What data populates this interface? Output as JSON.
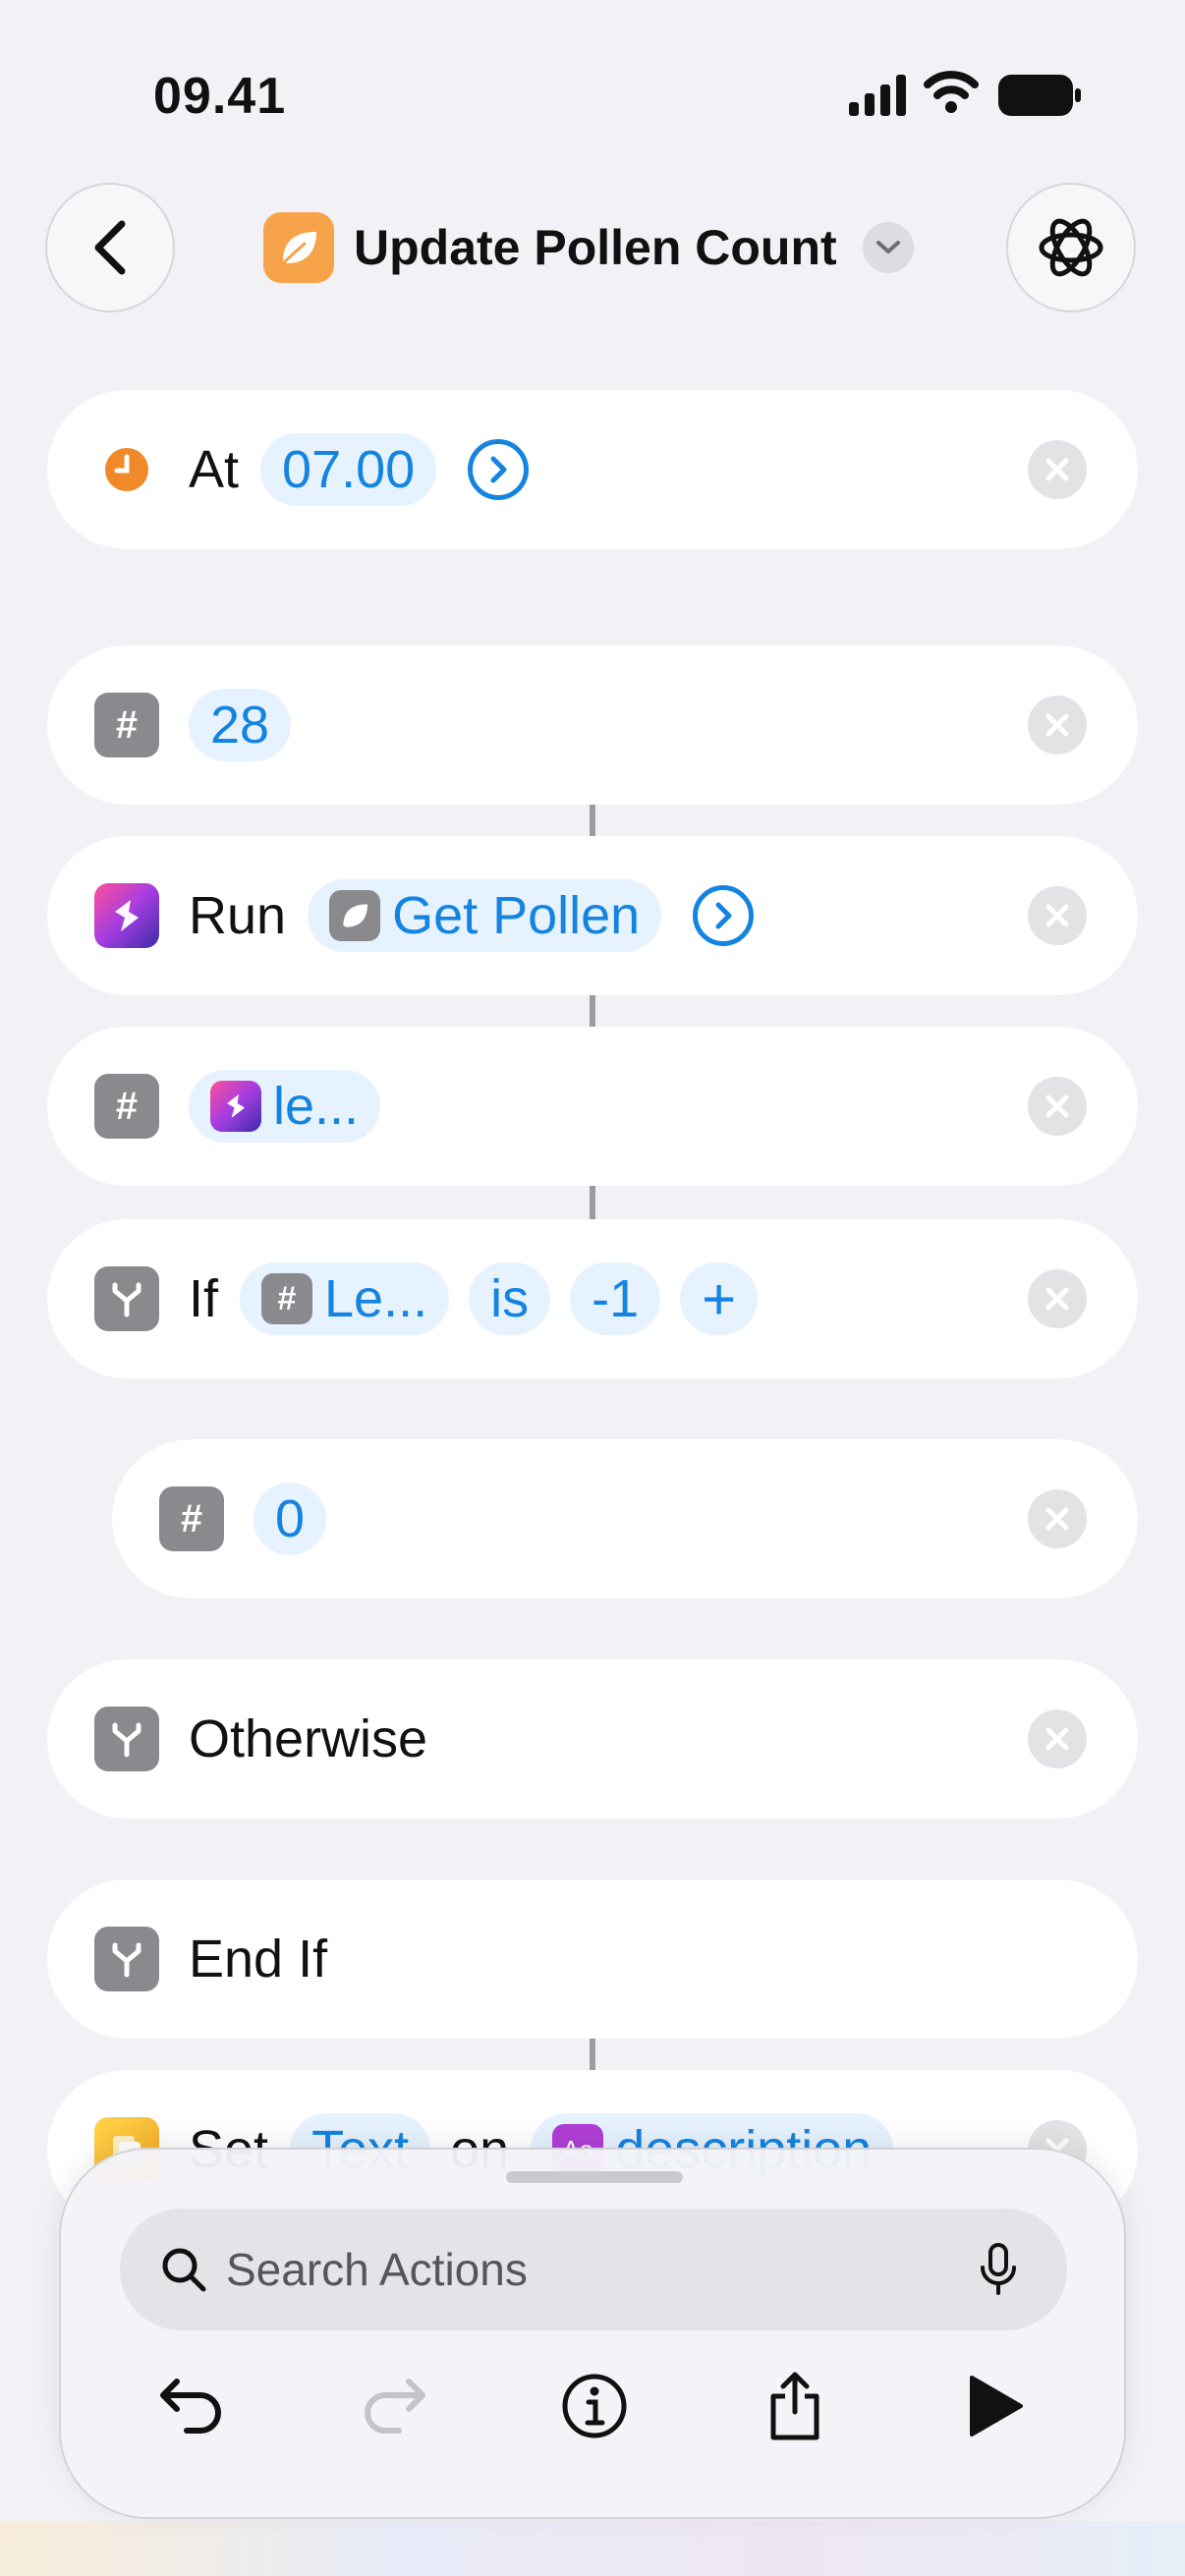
{
  "status_bar": {
    "time": "09.41"
  },
  "header": {
    "title": "Update Pollen Count"
  },
  "actions": {
    "trigger": {
      "keyword": "At",
      "time": "07.00"
    },
    "number1": {
      "value": "28"
    },
    "run": {
      "keyword": "Run",
      "shortcut": "Get Pollen"
    },
    "number2": {
      "value": "le..."
    },
    "if": {
      "keyword": "If",
      "variable": "Le...",
      "operator": "is",
      "value": "-1",
      "add": "+"
    },
    "number3": {
      "value": "0"
    },
    "otherwise": {
      "keyword": "Otherwise"
    },
    "end_if": {
      "keyword": "End If"
    },
    "set": {
      "keyword": "Set",
      "param": "Text",
      "on": "on",
      "target": "description"
    }
  },
  "bottom_sheet": {
    "search_placeholder": "Search Actions",
    "toolbar": [
      "undo",
      "redo",
      "info",
      "share",
      "play"
    ]
  },
  "colors": {
    "accent": "#1484e0",
    "app_icon": "#f6a34a",
    "gray_icon": "#8a8a8e"
  }
}
